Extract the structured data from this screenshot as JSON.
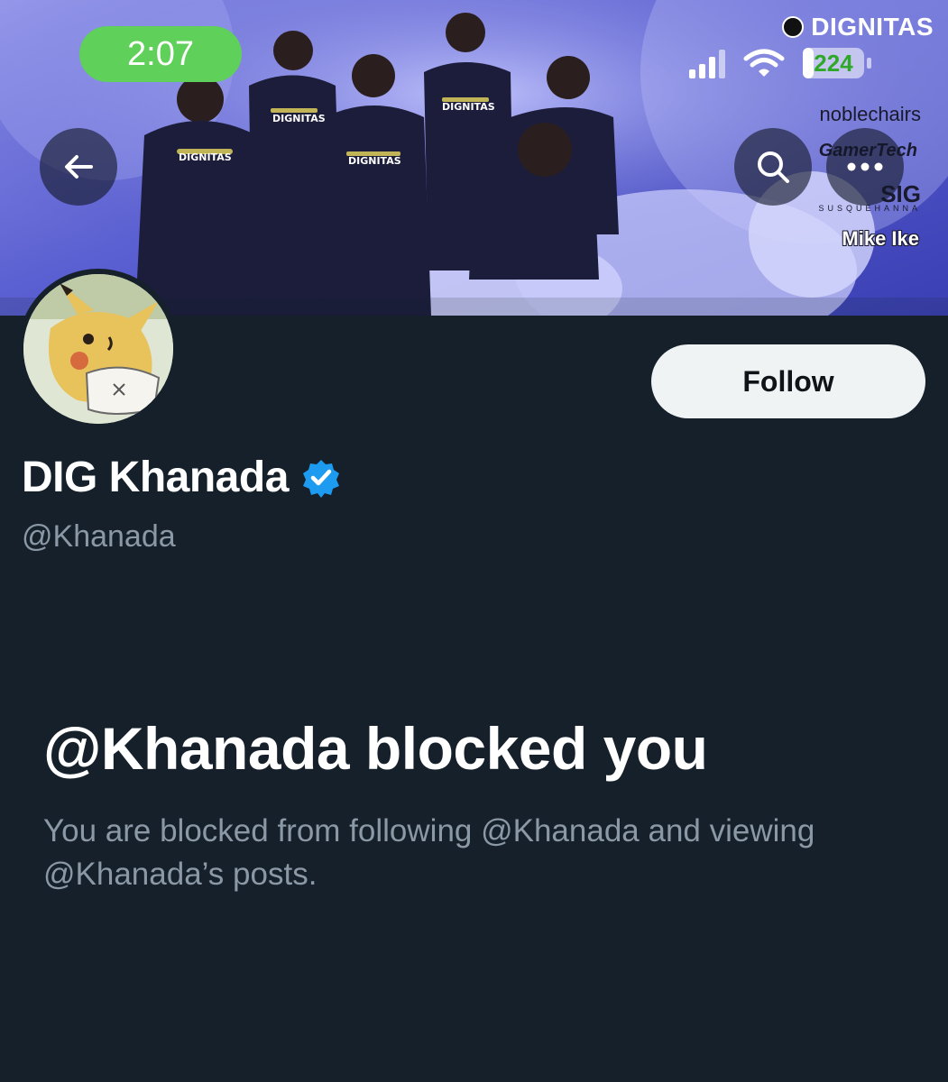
{
  "status_bar": {
    "time": "2:07",
    "battery_level": "224",
    "icons": [
      "signal-icon",
      "wifi-icon",
      "battery-icon"
    ]
  },
  "banner": {
    "sponsors": {
      "main": "DIGNITAS",
      "s1": "noblechairs",
      "s2": "GamerTech",
      "s3": "SIG",
      "s3_sub": "SUSQUEHANNA",
      "s4": "Mike Ike"
    }
  },
  "header": {
    "back_icon": "arrow-left-icon",
    "search_icon": "search-icon",
    "more_icon": "more-horizontal-icon"
  },
  "profile": {
    "display_name": "DIG Khanada",
    "verified": true,
    "handle": "@Khanada",
    "follow_label": "Follow"
  },
  "blocked": {
    "title": "@Khanada blocked you",
    "description": "You are blocked from following @Khanada and viewing @Khanada’s posts."
  },
  "colors": {
    "background": "#15202b",
    "secondary_text": "#8b98a5",
    "verified_badge": "#1d9bf0",
    "time_pill": "#5fd05a",
    "follow_button_bg": "#eff3f4"
  }
}
